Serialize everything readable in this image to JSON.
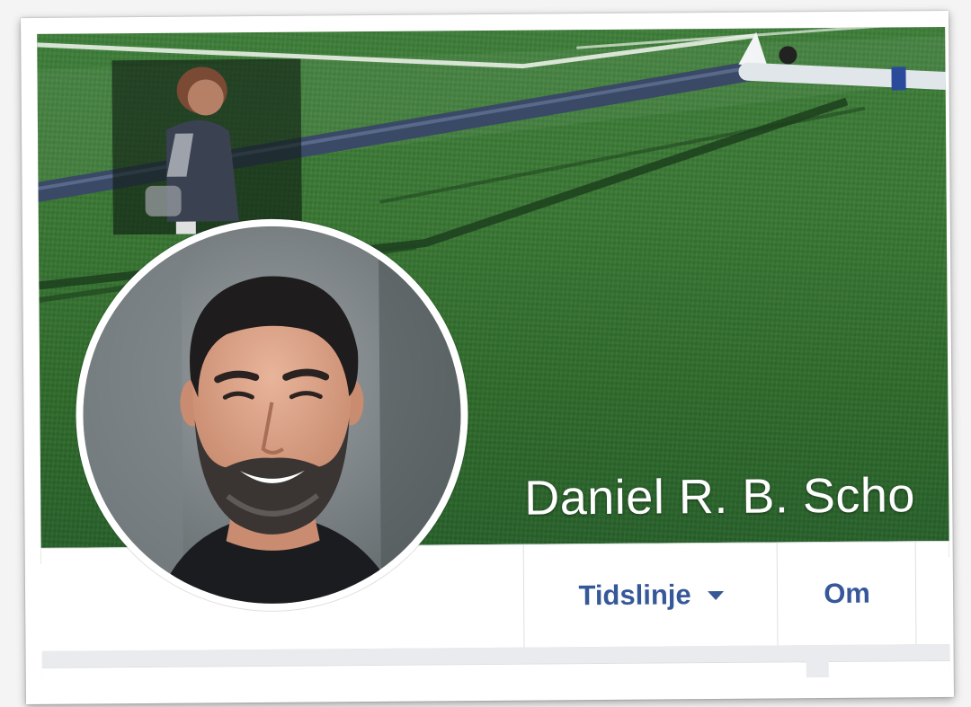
{
  "profile": {
    "name": "Daniel R. B. Scho"
  },
  "nav": {
    "tabs": [
      {
        "label": "Tidslinje",
        "has_dropdown": true
      },
      {
        "label": "Om",
        "has_dropdown": false
      }
    ]
  },
  "colors": {
    "link_blue": "#365899",
    "cover_grass": "#3a7834",
    "divider": "#dddfe2",
    "page_gray": "#e9ebee"
  },
  "icons": {
    "dropdown": "caret-down-icon"
  }
}
